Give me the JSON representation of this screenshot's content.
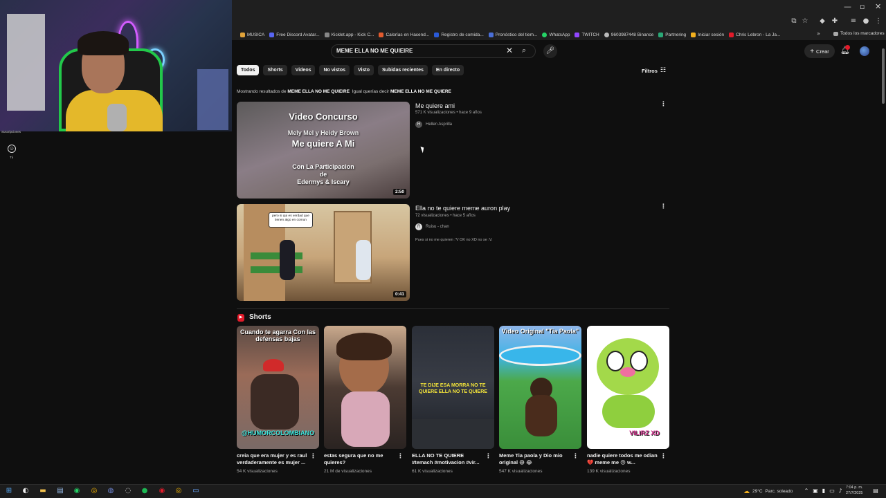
{
  "browser": {
    "bookmarks": [
      "MUSICA",
      "Free Discord Avatar...",
      "Kicklet.app - Kick C...",
      "Calorías en Hacend...",
      "Registro de comida...",
      "Pronóstico del tiem...",
      "WhatsApp",
      "TWITCH",
      "9603987448 Binance",
      "Partnering",
      "Iniciar sesión",
      "Chris Lebron - La Ja..."
    ],
    "all_bookmarks": "Todos los marcadores"
  },
  "sidebar": {
    "subscriptions": "Suscripciones",
    "you": "Tú"
  },
  "header": {
    "search_value": "MEME ELLA NO ME QUIEIRE",
    "create_label": "Crear"
  },
  "chips": [
    "Todos",
    "Shorts",
    "Videos",
    "No vistos",
    "Visto",
    "Subidas recientes",
    "En directo"
  ],
  "filters_label": "Filtros",
  "notice": {
    "prefix": "Mostrando resultados de",
    "query": "MEME ELLA NO ME QUIEIRE",
    "middle": "Igual querías decir",
    "suggestion": "MEME ELLA NO ME QUIERE"
  },
  "videos": [
    {
      "title": "Me quiere ami",
      "meta": "571 K visualizaciones • hace 9 años",
      "channel": "Hellen Asprilla",
      "channel_initial": "H",
      "duration": "2:50",
      "thumb_lines": [
        "Video Concurso",
        "Mely Mel y Heidy Brown",
        "Me quiere A Mi",
        "Con La Participacion",
        "de",
        "Edermys & Iscary"
      ]
    },
    {
      "title": "Ella no te quiere meme auron play",
      "meta": "72 visualizaciones • hace 5 años",
      "channel": "Ruisu - chan",
      "channel_initial": "R",
      "duration": "0:41",
      "description": "Pues si no me quieren :'V OK no XD no se :V.",
      "bubble": "pero si qui es verdad que tienen algo en comun"
    }
  ],
  "shorts_section": {
    "label": "Shorts"
  },
  "shorts": [
    {
      "title": "creia que era mujer y es raul verdaderamente es mujer ...",
      "views": "54 K visualizaciones",
      "overlay_top": "Cuando te agarra Con las defensas bajas",
      "overlay_bottom": "@HUMORCOLOMBIANO"
    },
    {
      "title": "estas segura que no me quieres?",
      "views": "21 M de visualizaciones"
    },
    {
      "title": "ELLA NO TE QUIERE #temach #motivacion #vir...",
      "views": "61 K visualizaciones",
      "overlay_mid": "TE DIJE ESA MORRA NO TE QUIERE ELLA NO TE QUIERE"
    },
    {
      "title": "Meme Tia paola y Dio mio original 😅 😂",
      "views": "547 K visualizaciones",
      "overlay_top": "Video Original \"Tia Paola\""
    },
    {
      "title": "nadie quiere todos me odian 💔 meme me 😢 w...",
      "views": "139 K visualizaciones",
      "overlay_bottom": "VILIRZ XD"
    }
  ],
  "taskbar": {
    "weather": "29°C",
    "weather_desc": "Parc. soleado",
    "time": "7:04 p. m.",
    "date": "27/7/2025"
  }
}
